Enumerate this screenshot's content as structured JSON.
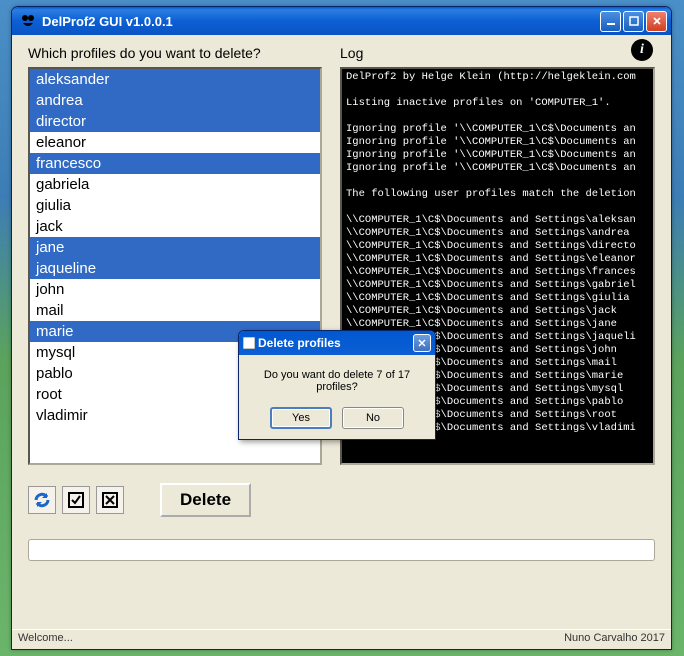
{
  "window": {
    "title": "DelProf2 GUI v1.0.0.1"
  },
  "labels": {
    "profiles_header": "Which profiles do you want to delete?",
    "log_header": "Log"
  },
  "profiles": [
    {
      "name": "aleksander",
      "selected": true
    },
    {
      "name": "andrea",
      "selected": true
    },
    {
      "name": "director",
      "selected": true
    },
    {
      "name": "eleanor",
      "selected": false
    },
    {
      "name": "francesco",
      "selected": true
    },
    {
      "name": "gabriela",
      "selected": false
    },
    {
      "name": "giulia",
      "selected": false
    },
    {
      "name": "jack",
      "selected": false
    },
    {
      "name": "jane",
      "selected": true
    },
    {
      "name": "jaqueline",
      "selected": true
    },
    {
      "name": "john",
      "selected": false
    },
    {
      "name": "mail",
      "selected": false
    },
    {
      "name": "marie",
      "selected": true
    },
    {
      "name": "mysql",
      "selected": false
    },
    {
      "name": "pablo",
      "selected": false
    },
    {
      "name": "root",
      "selected": false
    },
    {
      "name": "vladimir",
      "selected": false
    }
  ],
  "log_text": "DelProf2 by Helge Klein (http://helgeklein.com\n\nListing inactive profiles on 'COMPUTER_1'.\n\nIgnoring profile '\\\\COMPUTER_1\\C$\\Documents an\nIgnoring profile '\\\\COMPUTER_1\\C$\\Documents an\nIgnoring profile '\\\\COMPUTER_1\\C$\\Documents an\nIgnoring profile '\\\\COMPUTER_1\\C$\\Documents an\n\nThe following user profiles match the deletion\n\n\\\\COMPUTER_1\\C$\\Documents and Settings\\aleksan\n\\\\COMPUTER_1\\C$\\Documents and Settings\\andrea\n\\\\COMPUTER_1\\C$\\Documents and Settings\\directo\n\\\\COMPUTER_1\\C$\\Documents and Settings\\eleanor\n\\\\COMPUTER_1\\C$\\Documents and Settings\\frances\n\\\\COMPUTER_1\\C$\\Documents and Settings\\gabriel\n\\\\COMPUTER_1\\C$\\Documents and Settings\\giulia\n\\\\COMPUTER_1\\C$\\Documents and Settings\\jack\n\\\\COMPUTER_1\\C$\\Documents and Settings\\jane\n\\\\COMPUTER_1\\C$\\Documents and Settings\\jaqueli\n\\\\COMPUTER_1\\C$\\Documents and Settings\\john\n\\\\COMPUTER_1\\C$\\Documents and Settings\\mail\n\\\\COMPUTER_1\\C$\\Documents and Settings\\marie\n\\\\COMPUTER_1\\C$\\Documents and Settings\\mysql\n\\\\COMPUTER_1\\C$\\Documents and Settings\\pablo\n\\\\COMPUTER_1\\C$\\Documents and Settings\\root\n\\\\COMPUTER_1\\C$\\Documents and Settings\\vladimi",
  "toolbar": {
    "delete_label": "Delete"
  },
  "status": {
    "left": "Welcome...",
    "right": "Nuno Carvalho 2017"
  },
  "dialog": {
    "title": "Delete profiles",
    "message": "Do you want do delete 7 of 17 profiles?",
    "yes": "Yes",
    "no": "No"
  }
}
